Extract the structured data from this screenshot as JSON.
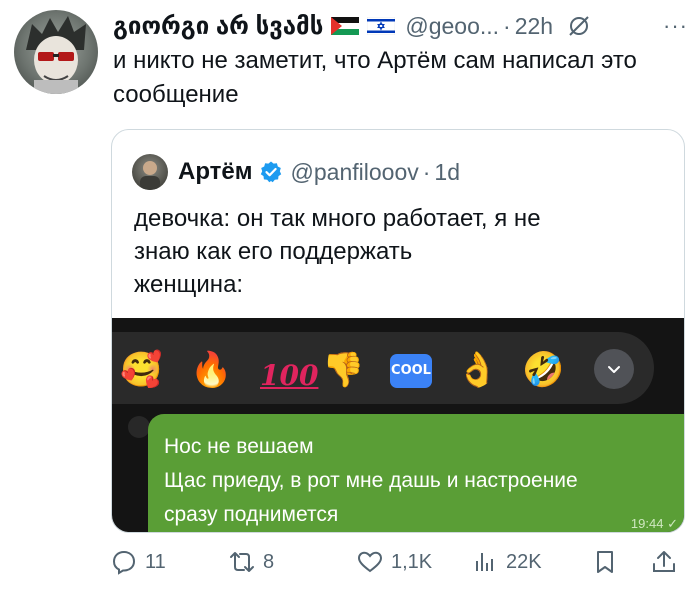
{
  "tweet": {
    "author_name": "გიორგი არ სვამს",
    "handle": "@geoo...",
    "dot": "·",
    "time": "22h",
    "more": "···",
    "text": "и никто не заметит, что Артём сам написал это сообщение"
  },
  "quote": {
    "author_name": "Артём",
    "handle": "@panfilooov",
    "dot": "·",
    "time": "1d",
    "text_lines": [
      "девочка: он так много работает, я не",
      "знаю как его поддержать",
      "женщина:"
    ],
    "media": {
      "reactions": [
        {
          "name": "smiling-face-with-hearts",
          "glyph": "🥰"
        },
        {
          "name": "fire",
          "glyph": "🔥"
        },
        {
          "name": "hundred-points",
          "glyph": "100"
        },
        {
          "name": "thumbs-down",
          "glyph": "👎"
        },
        {
          "name": "cool-button",
          "glyph": "COOL"
        },
        {
          "name": "ok-hand",
          "glyph": "👌"
        },
        {
          "name": "rolling-on-floor-laughing",
          "glyph": "🤣"
        }
      ],
      "message_lines": [
        "Нос не вешаем",
        "Щас приеду, в рот мне дашь и настроение",
        "сразу поднимется"
      ],
      "message_time": "19:44",
      "bubble_color": "#5a9e36"
    }
  },
  "actions": {
    "replies": "11",
    "retweets": "8",
    "likes": "1,1K",
    "views": "22K"
  },
  "colors": {
    "text": "#0f1419",
    "secondary": "#536471",
    "verified": "#1d9bf0",
    "border": "#cfd9de"
  }
}
